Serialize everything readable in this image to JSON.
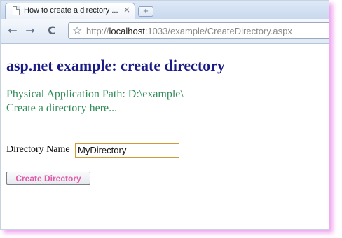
{
  "browser": {
    "tab_title": "How to create a directory ...",
    "tab_close": "×",
    "new_tab": "+",
    "back": "←",
    "forward": "→",
    "reload": "C",
    "bookmark_star": "☆",
    "url": {
      "scheme": "http://",
      "host": "localhost",
      "rest": ":1033/example/CreateDirectory.aspx"
    }
  },
  "page": {
    "heading": "asp.net example: create directory",
    "physical_path": "Physical Application Path: D:\\example\\",
    "create_here": "Create a directory here...",
    "directory_label": "Directory Name",
    "directory_value": "MyDirectory",
    "create_button": "Create Directory"
  },
  "icons": {
    "page": "page-icon",
    "close": "close-icon",
    "new_tab": "plus-icon",
    "back": "back-arrow-icon",
    "forward": "forward-arrow-icon",
    "reload": "reload-icon",
    "star": "star-icon"
  },
  "colors": {
    "heading": "#1b1b88",
    "info_text": "#2f8b57",
    "button_text": "#e05ca8",
    "input_border": "#d09b37",
    "window_shadow": "#f0a8f0"
  }
}
